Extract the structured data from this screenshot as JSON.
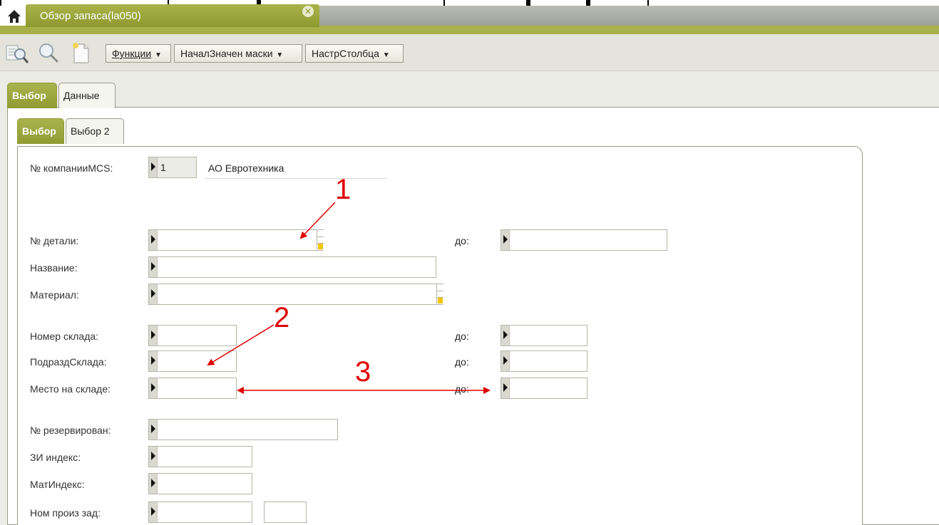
{
  "window": {
    "tab_title": "Обзор запаса(la050)",
    "home_icon": "home-icon",
    "close_icon": "close-icon"
  },
  "toolbar": {
    "icons": [
      "search-list-icon",
      "search-icon",
      "new-document-icon"
    ],
    "menus": [
      {
        "label": "Функции"
      },
      {
        "label": "НачалЗначен маски"
      },
      {
        "label": "НастрСтолбца"
      }
    ]
  },
  "colors": {
    "accent": "#a8b049",
    "annotation": "#e00000",
    "f4_indicator": "#f2c600"
  },
  "outer_tabs": [
    {
      "label": "Выбор",
      "active": true
    },
    {
      "label": "Данные",
      "active": false
    }
  ],
  "inner_tabs": [
    {
      "label": "Выбор",
      "active": true
    },
    {
      "label": "Выбор 2",
      "active": false
    }
  ],
  "form": {
    "company_label": "№ компанииMCS:",
    "company_value": "1",
    "company_name": "АО Евротехника",
    "to_label": "до:",
    "fields": [
      {
        "label": "№ детали:",
        "value": "",
        "has_to": true
      },
      {
        "label": "Название:",
        "value": "",
        "has_to": false
      },
      {
        "label": "Материал:",
        "value": "",
        "has_to": false
      },
      {
        "label": "Номер склада:",
        "value": "",
        "has_to": true
      },
      {
        "label": "ПодраздСклада:",
        "value": "",
        "has_to": true
      },
      {
        "label": "Место на складе:",
        "value": "",
        "has_to": true
      },
      {
        "label": "№ резервирован:",
        "value": "",
        "has_to": false
      },
      {
        "label": "ЗИ индекс:",
        "value": "",
        "has_to": false
      },
      {
        "label": "МатИндекс:",
        "value": "",
        "has_to": false
      },
      {
        "label": "Ном произ зад:",
        "value": "",
        "has_to": false
      }
    ]
  },
  "annotations": [
    "1",
    "2",
    "3"
  ]
}
